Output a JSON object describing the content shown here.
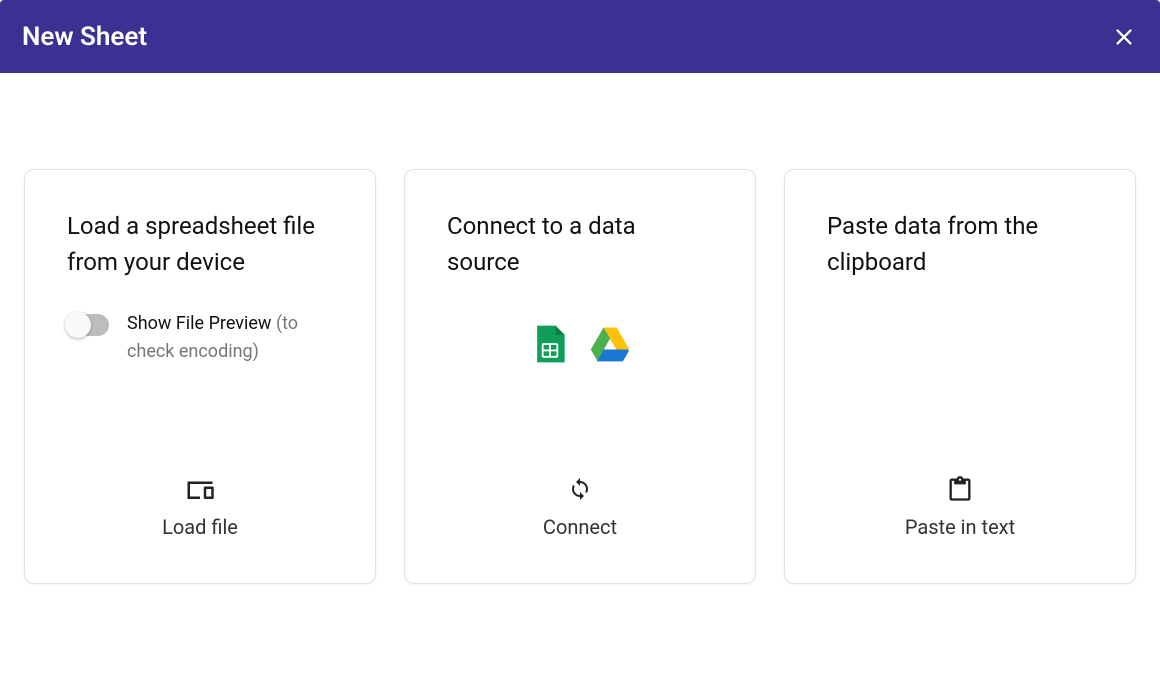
{
  "header": {
    "title": "New Sheet"
  },
  "cards": {
    "load_file": {
      "title": "Load a spreadsheet file from your device",
      "toggle_label": "Show File Preview",
      "toggle_hint": "(to check encoding)",
      "action_label": "Load file"
    },
    "connect": {
      "title": "Connect to a data source",
      "action_label": "Connect"
    },
    "paste": {
      "title": "Paste data from the clipboard",
      "action_label": "Paste in text"
    }
  }
}
